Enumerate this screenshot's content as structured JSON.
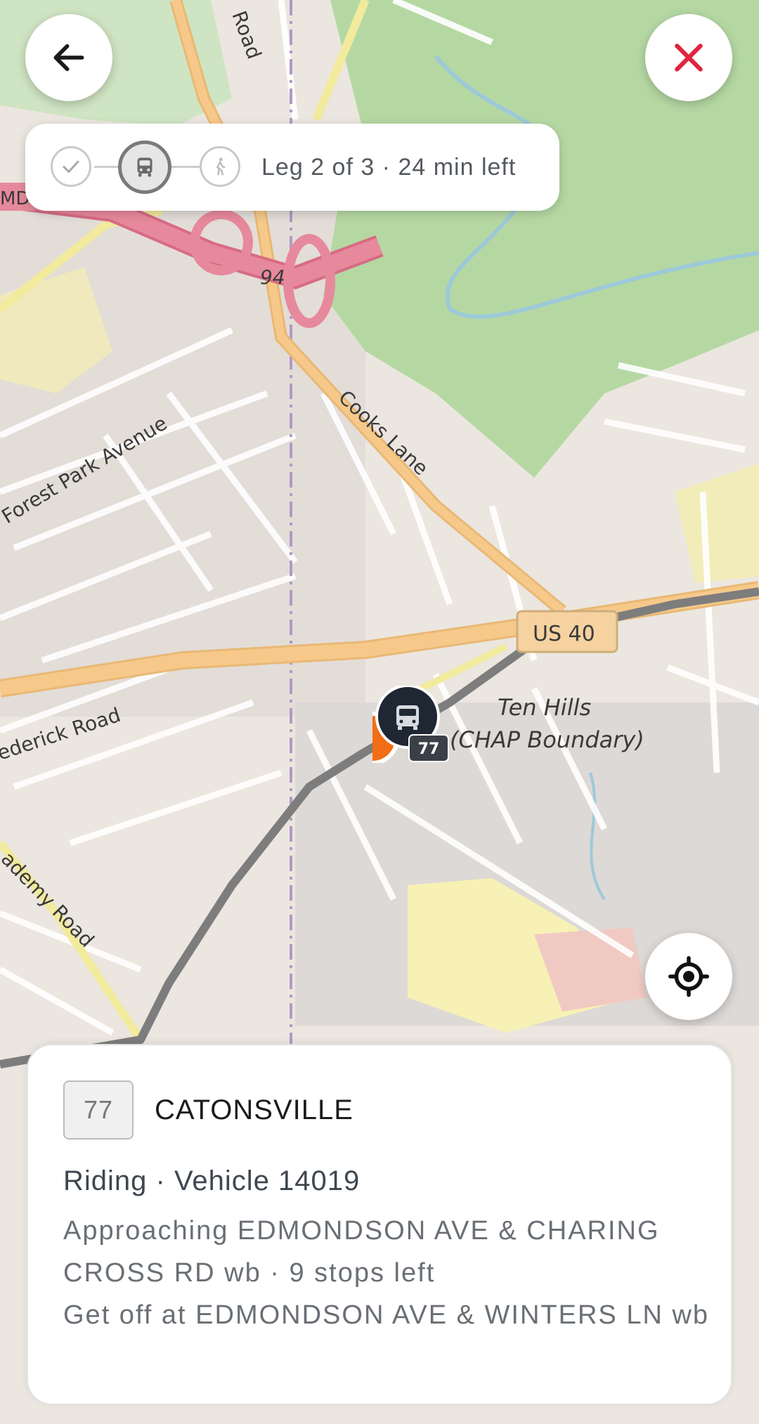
{
  "header": {
    "back_icon": "arrow-left-icon",
    "close_icon": "close-x-icon",
    "close_color": "#e0243f"
  },
  "progress": {
    "steps": [
      {
        "icon": "check-icon",
        "state": "done"
      },
      {
        "icon": "bus-icon",
        "state": "active"
      },
      {
        "icon": "walk-icon",
        "state": "upcoming"
      }
    ],
    "status": "Leg 2 of 3 · 24 min left"
  },
  "map": {
    "labels": {
      "road_forest_park": "Forest Park Avenue",
      "road_cooks": "Cooks Lane",
      "road_frederick": "ederick Road",
      "road_academy": "ademy Road",
      "road_top": "Road",
      "highway_94": "94",
      "highway_us40": "US 40",
      "area_ten_hills": "Ten Hills",
      "area_chap": "(CHAP Boundary)",
      "md_sign": "MD"
    },
    "vehicle_route": "77",
    "colors": {
      "route_line": "#7d7d7d",
      "user_dot": "#f26d16",
      "vehicle_marker": "#1f2733",
      "park": "#b5d8a3",
      "major_road": "#f6c98a",
      "motorway": "#e7899c"
    }
  },
  "locate_icon": "crosshair-locate-icon",
  "trip": {
    "route_number": "77",
    "route_name": "CATONSVILLE",
    "riding": "Riding · Vehicle 14019",
    "approaching": "Approaching EDMONDSON AVE & CHARING CROSS RD wb · 9 stops left",
    "get_off": "Get off at EDMONDSON AVE & WINTERS LN wb"
  }
}
